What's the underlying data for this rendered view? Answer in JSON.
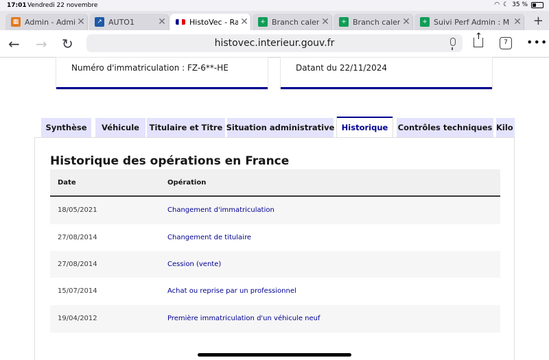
{
  "status_bar": {
    "time": "17:01",
    "date": "Vendredi 22 novembre",
    "battery": "35 %"
  },
  "browser_tabs": [
    {
      "title": "Admin - Admin",
      "icon": "grid-favicon-icon",
      "color": "#e07a1f",
      "active": false
    },
    {
      "title": "AUTO1",
      "icon": "auto1-favicon-icon",
      "color": "#1d5aa8",
      "active": false
    },
    {
      "title": "HistoVec - Rap",
      "icon": "france-flag-favicon-icon",
      "color": "#000091",
      "active": true
    },
    {
      "title": "Branch calenda",
      "icon": "sheets-favicon-icon",
      "color": "#0f9d58",
      "active": false
    },
    {
      "title": "Branch calenda",
      "icon": "sheets-favicon-icon",
      "color": "#0f9d58",
      "active": false
    },
    {
      "title": "Suivi Perf Admin : M",
      "icon": "sheets-favicon-icon",
      "color": "#0f9d58",
      "active": false
    }
  ],
  "toolbar": {
    "url": "histovec.interieur.gouv.fr",
    "tab_count": "7"
  },
  "cards": {
    "plate": "Numéro d'immatriculation : FZ-6**-HE",
    "dated": "Datant du 22/11/2024"
  },
  "page_tabs": [
    "Synthèse",
    "Véhicule",
    "Titulaire et Titre",
    "Situation administrative",
    "Historique",
    "Contrôles techniques",
    "Kilo"
  ],
  "active_tab": "Historique",
  "history": {
    "title": "Historique des opérations en France",
    "columns": {
      "date": "Date",
      "operation": "Opération"
    },
    "rows": [
      {
        "date": "18/05/2021",
        "operation": "Changement d'immatriculation"
      },
      {
        "date": "27/08/2014",
        "operation": "Changement de titulaire"
      },
      {
        "date": "27/08/2014",
        "operation": "Cession (vente)"
      },
      {
        "date": "15/07/2014",
        "operation": "Achat ou reprise par un professionnel"
      },
      {
        "date": "19/04/2012",
        "operation": "Première immatriculation d'un véhicule neuf"
      }
    ]
  },
  "colors": {
    "accent": "#000091",
    "tab_bg": "#e3e3fd"
  }
}
